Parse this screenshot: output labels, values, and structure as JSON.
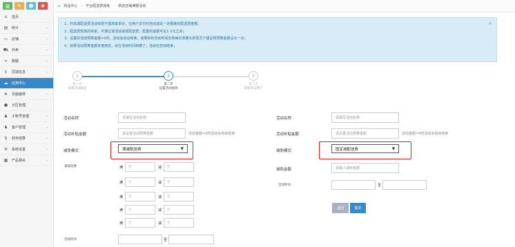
{
  "breadcrumb": {
    "home": "商品中心",
    "level2": "平台配送费减免",
    "current": "新店店铺满额活动"
  },
  "sidebar": {
    "top_colors": [
      "#5cb85c",
      "#f0ad4e",
      "#5bc0de",
      "#d9534f"
    ],
    "items": [
      {
        "icon": "home-icon",
        "label": "首页"
      },
      {
        "icon": "chart-icon",
        "label": "统计"
      },
      {
        "icon": "monitor-icon",
        "label": "店铺"
      },
      {
        "icon": "cart-icon",
        "label": "外卖"
      },
      {
        "icon": "bike-icon",
        "label": "跑腿"
      },
      {
        "icon": "info-icon",
        "label": "同城信息"
      },
      {
        "icon": "cloud-icon",
        "label": "应用中心",
        "active": true
      },
      {
        "icon": "star-icon",
        "label": "页面装修"
      },
      {
        "icon": "circle-icon",
        "label": "分区管理"
      },
      {
        "icon": "user-icon",
        "label": "子账号管理"
      },
      {
        "icon": "group-icon",
        "label": "客户管理"
      },
      {
        "icon": "yen-icon",
        "label": "财务结算"
      },
      {
        "icon": "gear-icon",
        "label": "系统设置"
      },
      {
        "icon": "grid-icon",
        "label": "产品相关"
      }
    ]
  },
  "info": {
    "lines": [
      "1、开启减配送费活动有助于提高客单价，在用户支付时自动减去一定额度的配送费金额；",
      "2、配送费较高的商家，可通过该活动减低配送费；配置的金额可在1-3元之间；",
      "3、设置的活动预算金额=0时，活动会自动结束，如果你的活动时间长和每日单量大的情况下建议将预算金额设大一点；",
      "4、如果活动预算金额未使用完，会在活动时间到期了，活动也自动结束；"
    ]
  },
  "steps": [
    {
      "num": "1",
      "t1": "第一步",
      "t2": "选择活动类型"
    },
    {
      "num": "2",
      "t1": "第二步",
      "t2": "设置活动规则"
    },
    {
      "num": "3",
      "t1": "第三步",
      "t2": "选择参与用户"
    }
  ],
  "left_form": {
    "name_label": "活动名称",
    "name_placeholder": "请填写活动名称",
    "budget_label": "活动补贴金额",
    "budget_placeholder": "请设置活动预算金额",
    "budget_note": "活动金额=0时活动会自动结束",
    "mode_label": "减免模式",
    "mode_value": "满减配送费",
    "tier_label": "满减优惠",
    "tiers": [
      {
        "k1": "满",
        "p1": "元",
        "k2": "减",
        "p2": "元"
      },
      {
        "k1": "满",
        "p1": "元",
        "k2": "减",
        "p2": "元"
      },
      {
        "k1": "满",
        "p1": "元",
        "k2": "减",
        "p2": "元"
      },
      {
        "k1": "满",
        "p1": "元",
        "k2": "减",
        "p2": "元"
      },
      {
        "k1": "满",
        "p1": "元",
        "k2": "减",
        "p2": "元"
      }
    ],
    "time_label": "活动时间",
    "time_sep": "至"
  },
  "right_form": {
    "name_label": "活动名称",
    "name_placeholder": "请填写活动名称",
    "budget_label": "活动补贴金额",
    "budget_placeholder": "请设置活动预算金额",
    "budget_note": "活动金额=0时活动会自动结束",
    "mode_label": "减免模式",
    "mode_value": "固定减配送费",
    "amount_label": "减免金额",
    "amount_placeholder": "请输入减免金额",
    "time_label": "活动时间",
    "time_sep": "至",
    "back_button": "返回",
    "submit_button": "提交"
  }
}
